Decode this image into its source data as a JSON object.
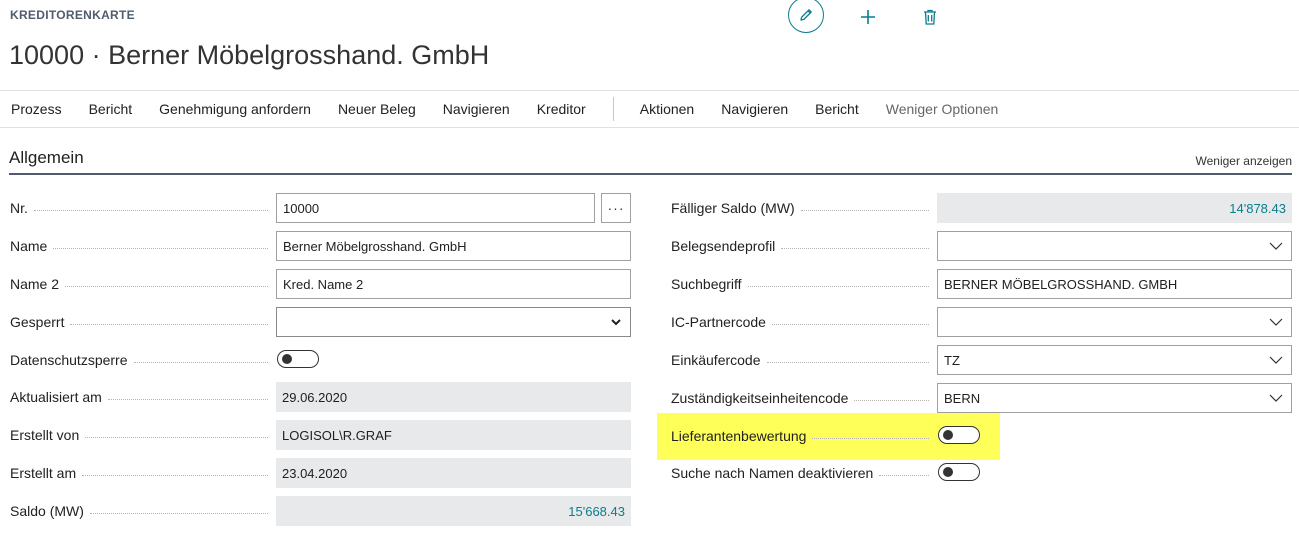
{
  "page": {
    "caption": "KREDITORENKARTE",
    "title": "10000 · Berner Möbelgrosshand. GmbH"
  },
  "actionbar": {
    "primary": [
      "Prozess",
      "Bericht",
      "Genehmigung anfordern",
      "Neuer Beleg",
      "Navigieren",
      "Kreditor"
    ],
    "secondary": [
      "Aktionen",
      "Navigieren",
      "Bericht"
    ],
    "less_options": "Weniger Optionen"
  },
  "section": {
    "title": "Allgemein",
    "toggle_link": "Weniger anzeigen"
  },
  "left_fields": {
    "nr": {
      "label": "Nr.",
      "value": "10000",
      "ellipsis": "···"
    },
    "name": {
      "label": "Name",
      "value": "Berner Möbelgrosshand. GmbH"
    },
    "name2": {
      "label": "Name 2",
      "value": "Kred. Name 2"
    },
    "gesperrt": {
      "label": "Gesperrt",
      "value": ""
    },
    "datenschutz": {
      "label": "Datenschutzsperre",
      "on": false
    },
    "aktualisiert": {
      "label": "Aktualisiert am",
      "value": "29.06.2020"
    },
    "erstellt_von": {
      "label": "Erstellt von",
      "value": "LOGISOL\\R.GRAF"
    },
    "erstellt_am": {
      "label": "Erstellt am",
      "value": "23.04.2020"
    },
    "saldo": {
      "label": "Saldo (MW)",
      "value": "15'668.43"
    }
  },
  "right_fields": {
    "faelliger_saldo": {
      "label": "Fälliger Saldo (MW)",
      "value": "14'878.43"
    },
    "belegsendeprofil": {
      "label": "Belegsendeprofil",
      "value": ""
    },
    "suchbegriff": {
      "label": "Suchbegriff",
      "value": "BERNER MÖBELGROSSHAND. GMBH"
    },
    "ic_partnercode": {
      "label": "IC-Partnercode",
      "value": ""
    },
    "einkaeufercode": {
      "label": "Einkäufercode",
      "value": "TZ"
    },
    "zustaendigkeit": {
      "label": "Zuständigkeitseinheitencode",
      "value": "BERN"
    },
    "lieferantenbewertung": {
      "label": "Lieferantenbewertung",
      "on": false
    },
    "suche_namen": {
      "label": "Suche nach Namen deaktivieren",
      "on": false
    }
  },
  "icons": {
    "edit": "pencil-icon",
    "new": "plus-icon",
    "delete": "trash-icon"
  },
  "colors": {
    "accent": "#0a7d8c",
    "highlight": "#ffff5a",
    "readonly_bg": "#e8e9ea"
  }
}
